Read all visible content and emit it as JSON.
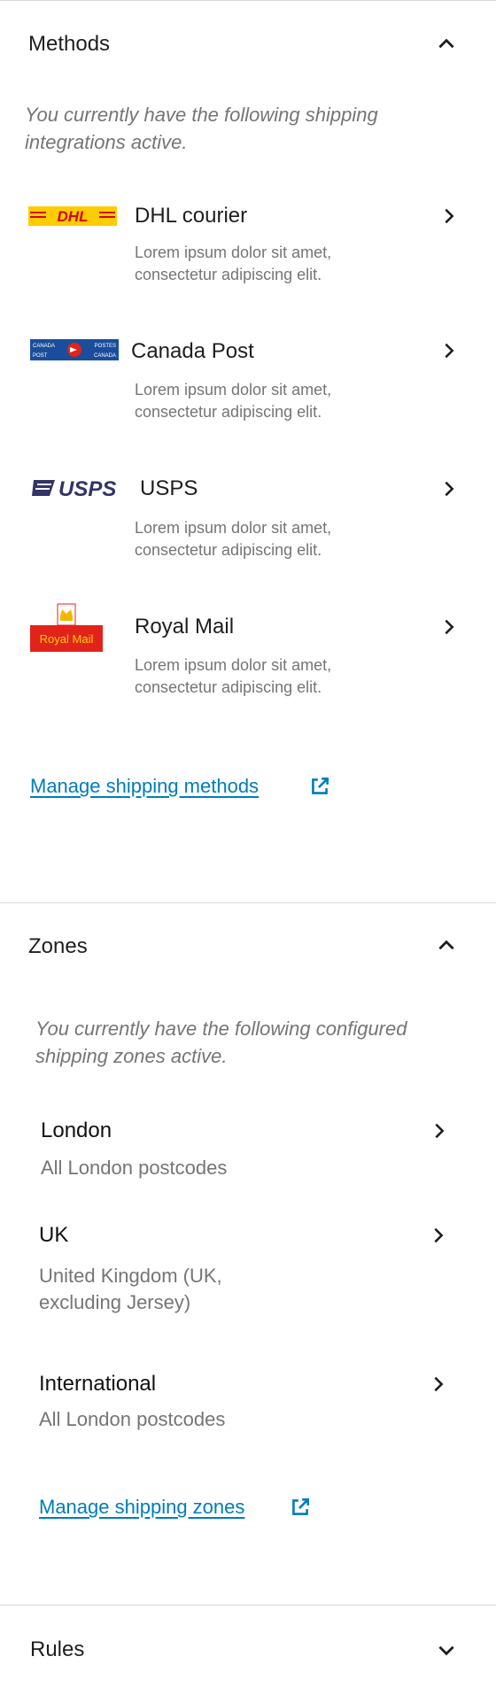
{
  "methods": {
    "title": "Methods",
    "intro": "You currently have the following shipping integrations active.",
    "items": [
      {
        "logo": "dhl-logo",
        "name": "DHL courier",
        "desc": "Lorem ipsum dolor sit amet, consectetur adipiscing elit.",
        "logo_text": "DHL"
      },
      {
        "logo": "canada-post-logo",
        "name": "Canada Post",
        "desc": "Lorem ipsum dolor sit amet, consectetur adipiscing elit.",
        "logo_text": [
          "CANADA",
          "POSTES",
          "POST",
          "CANADA"
        ]
      },
      {
        "logo": "usps-logo",
        "name": "USPS",
        "desc": "Lorem ipsum dolor sit amet, consectetur adipiscing elit.",
        "logo_text": "USPS"
      },
      {
        "logo": "royal-mail-logo",
        "name": "Royal Mail",
        "desc": "Lorem ipsum dolor sit amet, consectetur adipiscing elit.",
        "logo_text": "Royal Mail"
      }
    ],
    "manage_link": "Manage shipping methods"
  },
  "zones": {
    "title": "Zones",
    "intro": "You currently have the following configured shipping zones active.",
    "items": [
      {
        "name": "London",
        "desc": "All London postcodes"
      },
      {
        "name": "UK",
        "desc": "United Kingdom (UK, excluding Jersey)"
      },
      {
        "name": "International",
        "desc": "All London postcodes"
      }
    ],
    "manage_link": "Manage shipping zones"
  },
  "rules": {
    "title": "Rules"
  },
  "colors": {
    "link": "#007cba",
    "muted": "#757575",
    "text": "#1e1e1e",
    "dhl_yellow": "#ffcc00",
    "dhl_red": "#d40511",
    "usps_blue": "#333366",
    "canada_post_blue": "#1a4e9c",
    "royal_mail_red": "#e2231a"
  }
}
